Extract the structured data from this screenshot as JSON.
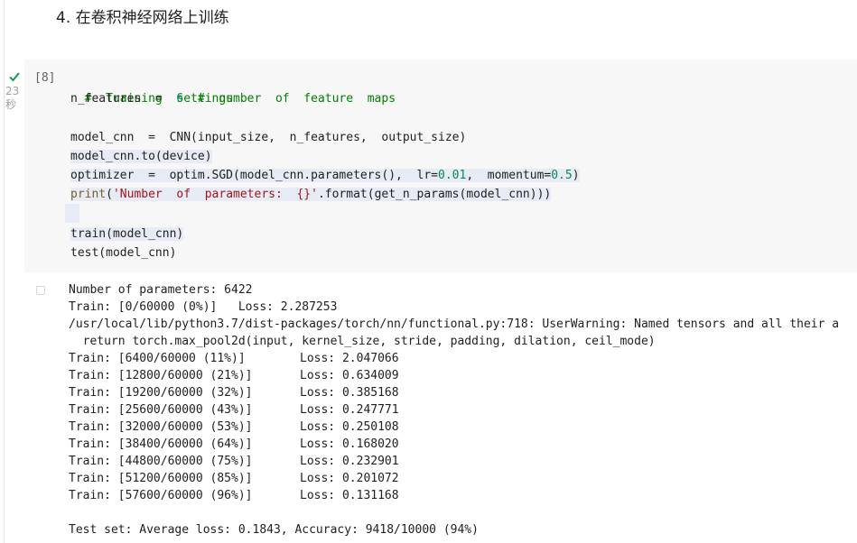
{
  "heading": "4. 在卷积神经网络上训练",
  "cell": {
    "status": "completed",
    "duration_value": "23",
    "duration_unit": "秒",
    "exec_count": "[8]",
    "code": {
      "l1": "#  Training  settings",
      "l2_a": "n_features  =  ",
      "l2_num": "6",
      "l2_comment": "  #  number  of  feature  maps",
      "l4": "model_cnn  =  CNN(input_size,  n_features,  output_size)",
      "l5": "model_cnn.to(device)",
      "l6_a": "optimizer  =  optim.SGD(model_cnn.parameters(),  lr=",
      "l6_num1": "0.01",
      "l6_b": ",  momentum=",
      "l6_num2": "0.5",
      "l6_c": ")",
      "l7_fn": "print",
      "l7_a": "(",
      "l7_str": "'Number  of  parameters:  {}'",
      "l7_b": ".format(get_n_params(model_cnn)))",
      "l9": "train(model_cnn)",
      "l10": "test(model_cnn)"
    }
  },
  "output": {
    "params_line": "Number of parameters: 6422",
    "first_train": "Train: [0/60000 (0%)]   Loss: 2.287253",
    "warning_line": "/usr/local/lib/python3.7/dist-packages/torch/nn/functional.py:718: UserWarning: Named tensors and all their a",
    "warning_source": "  return torch.max_pool2d(input, kernel_size, stride, padding, dilation, ceil_mode)",
    "train_rows": [
      {
        "progress": "Train: [6400/60000 (11%)]",
        "loss": "Loss: 2.047066"
      },
      {
        "progress": "Train: [12800/60000 (21%)]",
        "loss": "Loss: 0.634009"
      },
      {
        "progress": "Train: [19200/60000 (32%)]",
        "loss": "Loss: 0.385168"
      },
      {
        "progress": "Train: [25600/60000 (43%)]",
        "loss": "Loss: 0.247771"
      },
      {
        "progress": "Train: [32000/60000 (53%)]",
        "loss": "Loss: 0.250108"
      },
      {
        "progress": "Train: [38400/60000 (64%)]",
        "loss": "Loss: 0.168020"
      },
      {
        "progress": "Train: [44800/60000 (75%)]",
        "loss": "Loss: 0.232901"
      },
      {
        "progress": "Train: [51200/60000 (85%)]",
        "loss": "Loss: 0.201072"
      },
      {
        "progress": "Train: [57600/60000 (96%)]",
        "loss": "Loss: 0.131168"
      }
    ],
    "test_line": "Test set: Average loss: 0.1843, Accuracy: 9418/10000 (94%)"
  },
  "colors": {
    "comment": "#008000",
    "number": "#09885a",
    "string": "#a31515",
    "check": "#0f9d58"
  }
}
